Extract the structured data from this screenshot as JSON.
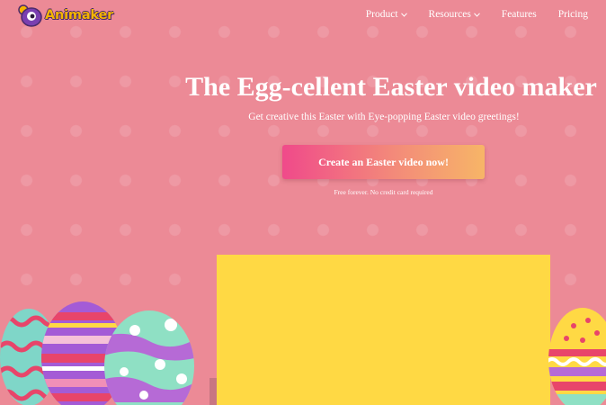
{
  "header": {
    "brand": "Animaker",
    "nav": [
      {
        "label": "Product",
        "has_dropdown": true
      },
      {
        "label": "Resources",
        "has_dropdown": true
      },
      {
        "label": "Features",
        "has_dropdown": false
      },
      {
        "label": "Pricing",
        "has_dropdown": false
      }
    ]
  },
  "hero": {
    "title": "The Egg-cellent Easter video maker",
    "subtitle": "Get creative this Easter with Eye-popping Easter video greetings!",
    "cta_label": "Create an Easter video now!",
    "note": "Free forever. No credit card required"
  },
  "colors": {
    "background": "#ec8a96",
    "cta_start": "#f04a8a",
    "cta_end": "#f7b567",
    "video_panel": "#ffd944",
    "brand_text": "#f4b400"
  },
  "icons": {
    "logo": "animaker-logo-icon",
    "dropdown": "chevron-down-icon"
  }
}
